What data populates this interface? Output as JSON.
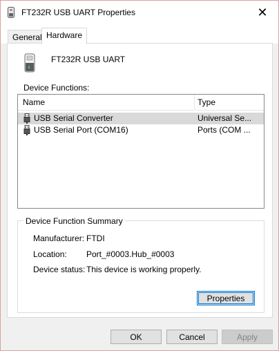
{
  "window": {
    "title": "FT232R USB UART Properties",
    "close_glyph": "✕"
  },
  "tabs": [
    {
      "label": "General",
      "selected": false
    },
    {
      "label": "Hardware",
      "selected": true
    }
  ],
  "device": {
    "name": "FT232R USB UART",
    "icon": "usb-device-icon"
  },
  "functions": {
    "label": "Device Functions:",
    "columns": [
      "Name",
      "Type"
    ],
    "rows": [
      {
        "name": "USB Serial Converter",
        "type": "Universal Se...",
        "selected": true,
        "icon": "usb-plug-icon"
      },
      {
        "name": "USB Serial Port (COM16)",
        "type": "Ports (COM ...",
        "selected": false,
        "icon": "serial-port-icon"
      }
    ]
  },
  "summary": {
    "legend": "Device Function Summary",
    "manufacturer_label": "Manufacturer:",
    "manufacturer_value": "FTDI",
    "location_label": "Location:",
    "location_value": "Port_#0003.Hub_#0003",
    "status_label": "Device status:",
    "status_value": "This device is working properly.",
    "properties_button": "Properties"
  },
  "buttons": {
    "ok": "OK",
    "cancel": "Cancel",
    "apply": "Apply"
  },
  "colors": {
    "accent": "#0078d7",
    "selection": "#d9d9d9",
    "window_border": "#d9a0a0"
  }
}
